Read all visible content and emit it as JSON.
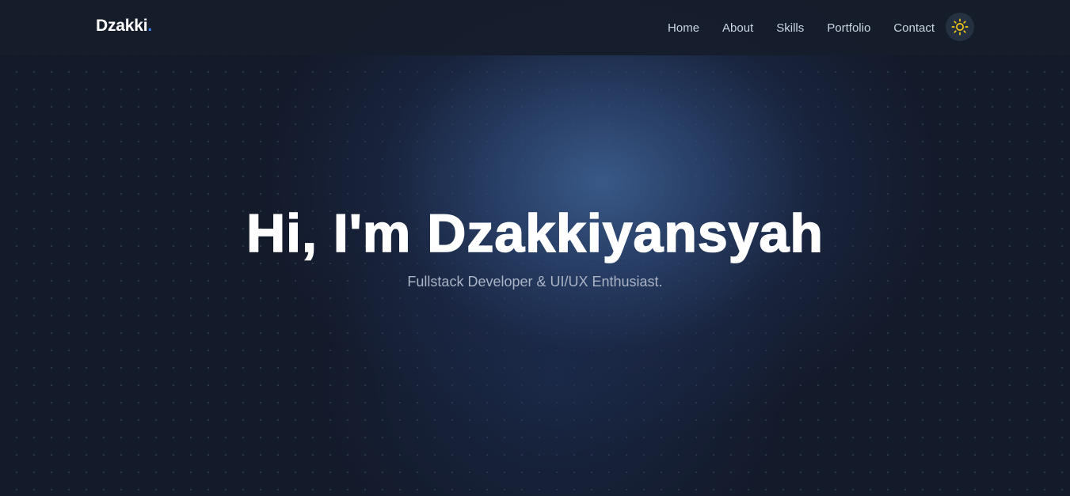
{
  "nav": {
    "brand": "Dzakki",
    "brand_dot": ".",
    "links": [
      "Home",
      "About",
      "Skills",
      "Portfolio",
      "Contact"
    ],
    "theme_icon": "sun-icon"
  },
  "hero": {
    "title": "Hi, I'm Dzakkiyansyah",
    "subtitle": "Fullstack Developer & UI/UX Enthusiast."
  },
  "colors": {
    "background": "#131a2a",
    "accent": "#3b82f6",
    "sun": "#facc15",
    "nav_text": "#cbd5e1"
  }
}
